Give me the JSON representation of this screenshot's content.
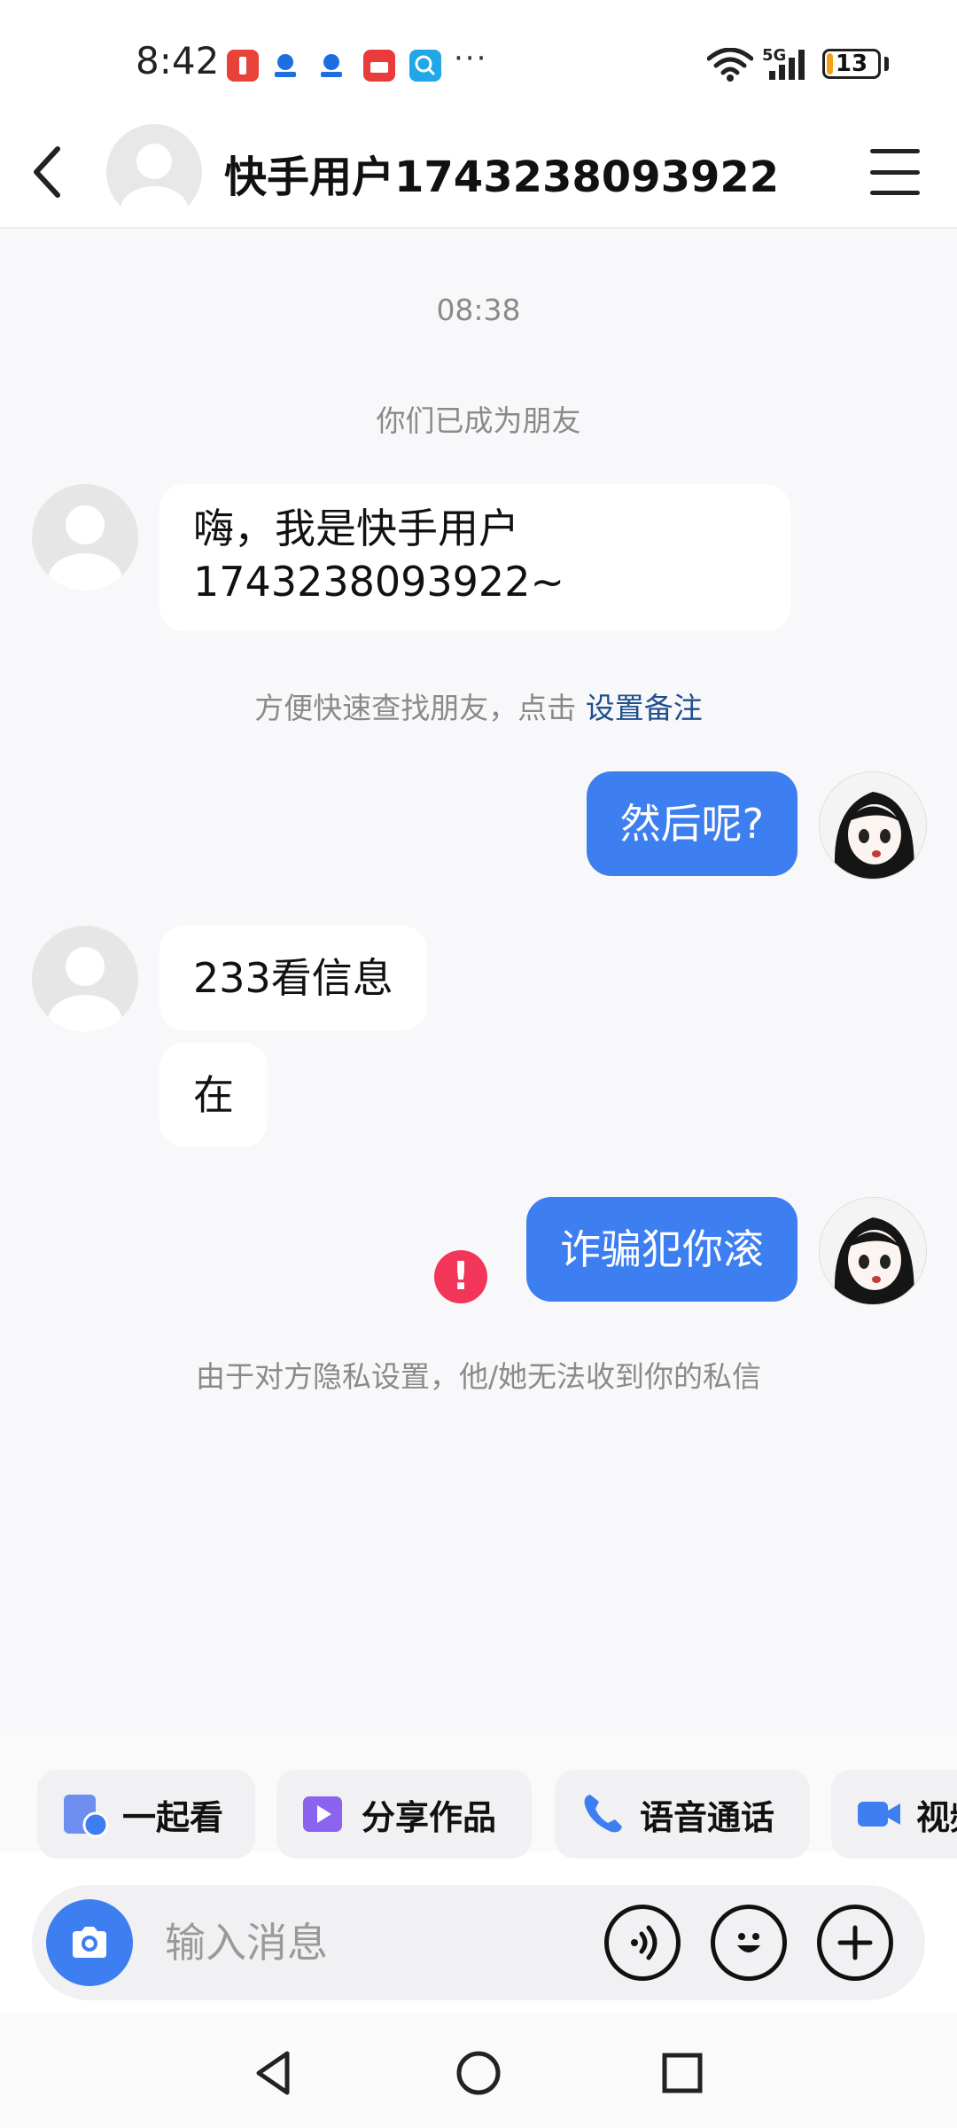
{
  "status_bar": {
    "time": "8:42",
    "network": "5G",
    "battery": "13",
    "battery_level_percent": 13,
    "more": "···"
  },
  "header": {
    "title": "快手用户1743238093922"
  },
  "chat": {
    "timestamp": "08:38",
    "friend_notice": "你们已成为朋友",
    "greeting": "嗨，我是快手用户1743238093922~",
    "remark_hint": "方便快速查找朋友，点击",
    "remark_link": "设置备注",
    "msg_out_1": "然后呢?",
    "msg_in_1": "233看信息",
    "msg_in_2": "在",
    "msg_out_2": "诈骗犯你滚",
    "error_mark": "!",
    "privacy_notice": "由于对方隐私设置，他/她无法收到你的私信"
  },
  "quick_actions": [
    {
      "label": "一起看",
      "icon": "watch-together-icon"
    },
    {
      "label": "分享作品",
      "icon": "share-work-icon"
    },
    {
      "label": "语音通话",
      "icon": "phone-icon"
    },
    {
      "label": "视频",
      "icon": "video-icon"
    }
  ],
  "input": {
    "placeholder": "输入消息"
  },
  "colors": {
    "accent": "#3d7ef0",
    "error": "#f2365a",
    "link": "#1f4f8f"
  }
}
